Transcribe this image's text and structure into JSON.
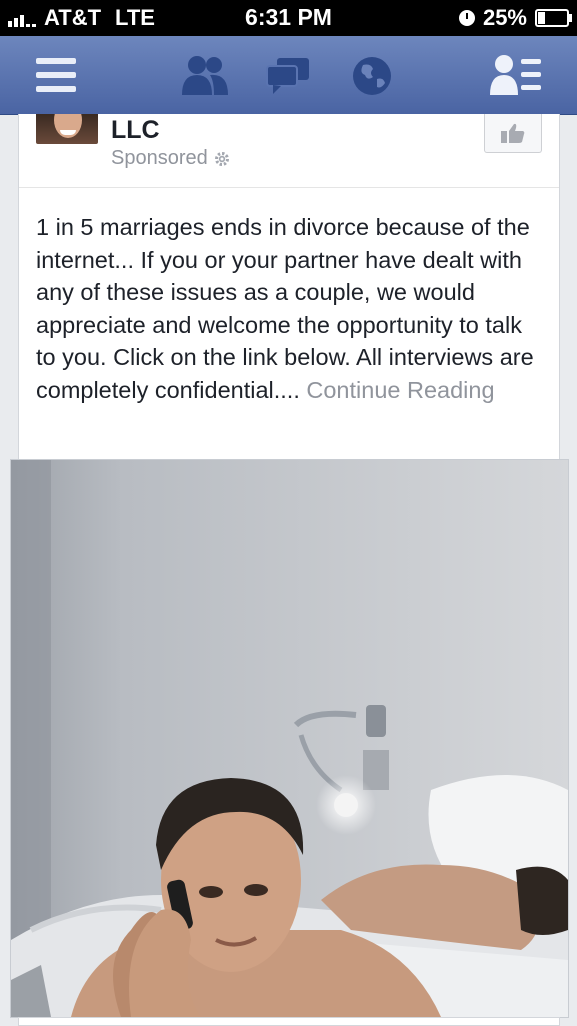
{
  "status_bar": {
    "carrier": "AT&T",
    "network": "LTE",
    "time": "6:31 PM",
    "battery": "25%",
    "battery_level": 0.25
  },
  "nav_bar": {
    "icons": [
      "menu-icon",
      "friend-requests-icon",
      "messages-icon",
      "notifications-globe-icon",
      "contacts-icon"
    ]
  },
  "post": {
    "page_name": "LLC",
    "sponsored_label": "Sponsored",
    "body": "1 in 5 marriages ends in divorce because of the internet... If you or your partner have dealt with any of these issues as a couple, we would appreciate and welcome the opportunity to talk to you. Click on the link below. All interviews are completely confidential....",
    "continue_label": "Continue Reading"
  },
  "colors": {
    "nav_bar": "#5470b0",
    "link_gray": "#90949c",
    "text": "#1d2129"
  }
}
